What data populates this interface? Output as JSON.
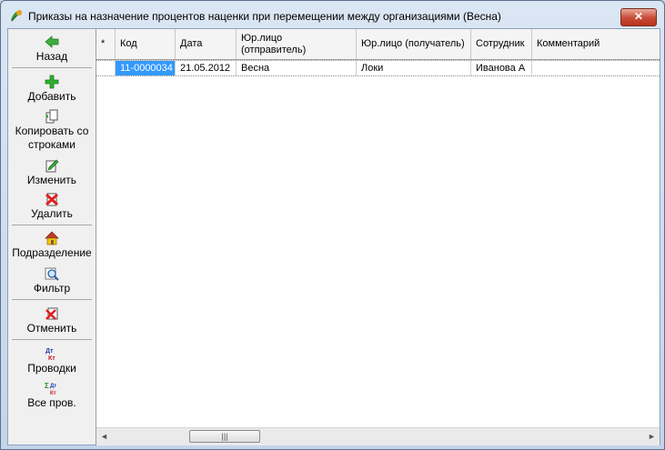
{
  "window": {
    "title": "Приказы на назначение процентов наценки при перемещении между организациями (Весна)",
    "close_label": "✕"
  },
  "toolbar": {
    "back": "Назад",
    "add": "Добавить",
    "copy_rows_1": "Копировать со",
    "copy_rows_2": "строками",
    "edit": "Изменить",
    "delete": "Удалить",
    "subdivision": "Подразделение",
    "filter": "Фильтр",
    "cancel": "Отменить",
    "postings": "Проводки",
    "all_postings": "Все пров."
  },
  "table": {
    "headers": [
      "*",
      "Код",
      "Дата",
      "Юр.лицо",
      "(отправитель)",
      "Юр.лицо (получатель)",
      "Сотрудник",
      "Комментарий"
    ],
    "rows": [
      [
        "",
        "11-0000034",
        "21.05.2012",
        "Весна",
        "Локи",
        "Иванова А",
        ""
      ]
    ]
  },
  "scrollbar": {
    "left": "◄",
    "right": "►",
    "grip": "|||"
  }
}
